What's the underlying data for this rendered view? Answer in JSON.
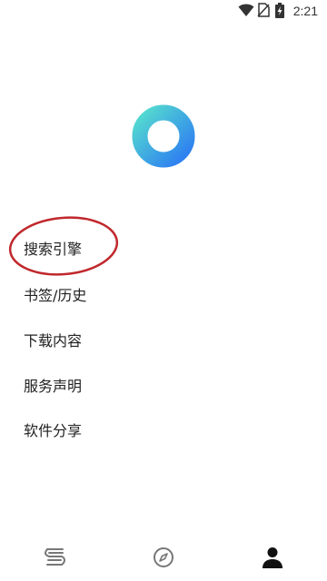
{
  "status_bar": {
    "time": "2:21",
    "battery_level": "charging",
    "icons": [
      "wifi-icon",
      "no-sim-icon",
      "battery-charging-icon"
    ]
  },
  "logo": {
    "icon": "ring-logo-icon",
    "colors": {
      "start": "#4fd6d6",
      "end": "#2f7ef5"
    }
  },
  "menu": {
    "items": [
      {
        "label": "搜索引擎"
      },
      {
        "label": "书签/历史"
      },
      {
        "label": "下载内容"
      },
      {
        "label": "服务声明"
      },
      {
        "label": "软件分享"
      }
    ]
  },
  "annotation": {
    "shape": "red-ellipse",
    "color": "#c0282c",
    "target": "搜索引擎"
  },
  "bottom_nav": {
    "items": [
      {
        "icon": "tabs-icon",
        "active": false
      },
      {
        "icon": "compass-icon",
        "active": false
      },
      {
        "icon": "person-icon",
        "active": true
      }
    ],
    "active_color": "#111111",
    "inactive_color": "#777777"
  }
}
